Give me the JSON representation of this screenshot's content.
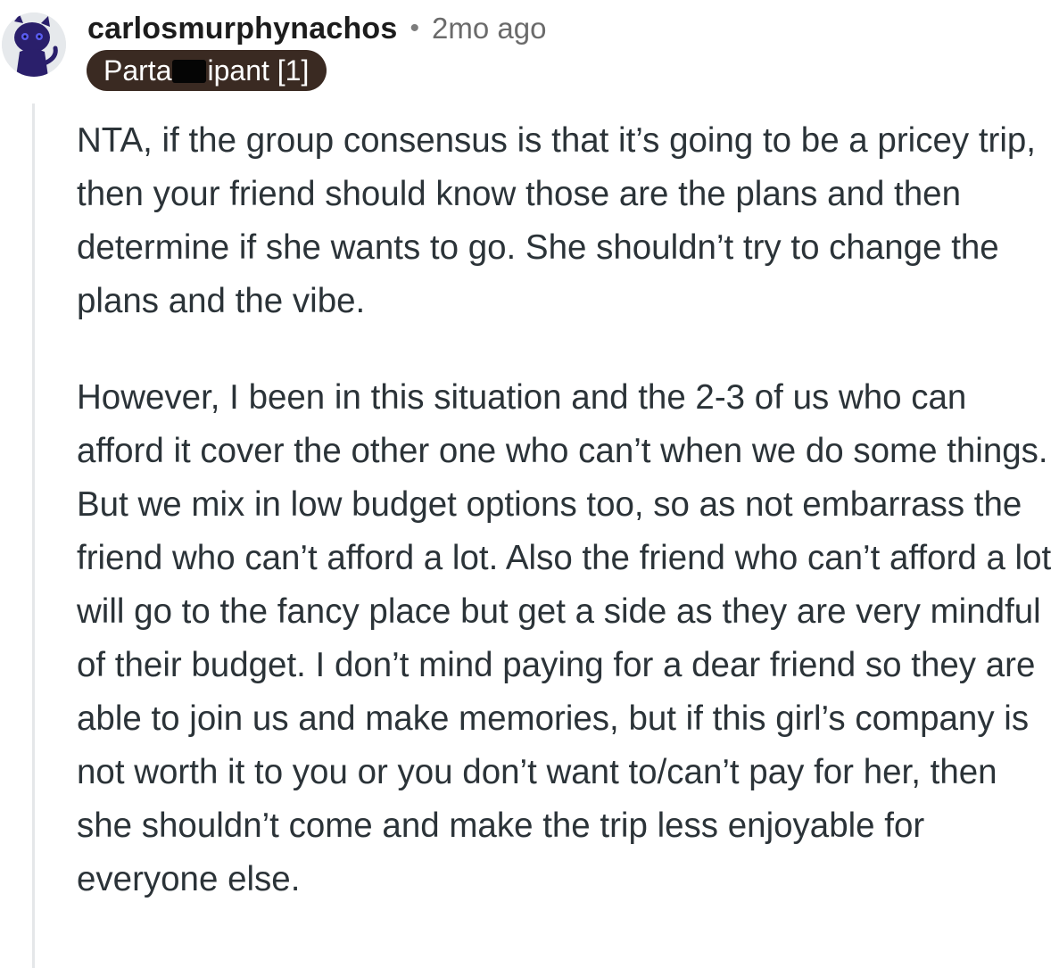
{
  "comment": {
    "username": "carlosmurphynachos",
    "separator": "•",
    "timestamp": "2mo ago",
    "flair": {
      "before_redaction": "Parta",
      "after_redaction": "ipant [1]"
    },
    "avatar_icon": "cat-avatar-icon",
    "paragraphs": [
      "NTA, if the group consensus is that it’s going to be a pricey trip, then your friend should know those are the plans and then determine if she wants to go. She shouldn’t try to change the plans and the vibe.",
      "However, I been in this situation and the 2-3 of us who can afford it cover the other one who can’t when we do some things. But we mix in low budget options too, so as not embarrass the friend who can’t afford a lot. Also the friend who can’t afford a lot will go to the fancy place but get a side as they are very mindful of their budget. I don’t mind paying for a dear friend so they are able to join us and make memories, but if this girl’s company is not worth it to you or you don’t want to/can’t pay for her, then she shouldn’t come and make the trip less enjoyable for everyone else."
    ]
  },
  "colors": {
    "flair_background": "#3a2a22",
    "thread_line": "#e5e7e9",
    "avatar_cat": "#2a1f6b"
  }
}
